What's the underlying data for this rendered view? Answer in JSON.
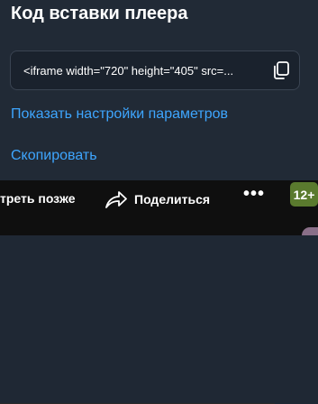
{
  "dialog": {
    "title": "Код вставки плеера",
    "embed_code": "<iframe width=\"720\" height=\"405\" src=...",
    "show_settings_link": "Показать настройки параметров",
    "copy_link": "Скопировать"
  },
  "player_bar": {
    "watch_later_label": "треть позже",
    "share_label": "Поделиться",
    "more_label": "•••",
    "age_badge": "12+"
  },
  "icons": {
    "copy": "copy-icon",
    "share": "share-arrow-icon",
    "more": "more-dots-icon"
  },
  "colors": {
    "panel_bg": "#212a36",
    "link": "#3ea6ff",
    "badge_bg": "#5a7a2e",
    "bar_bg": "#0f0f0f"
  }
}
